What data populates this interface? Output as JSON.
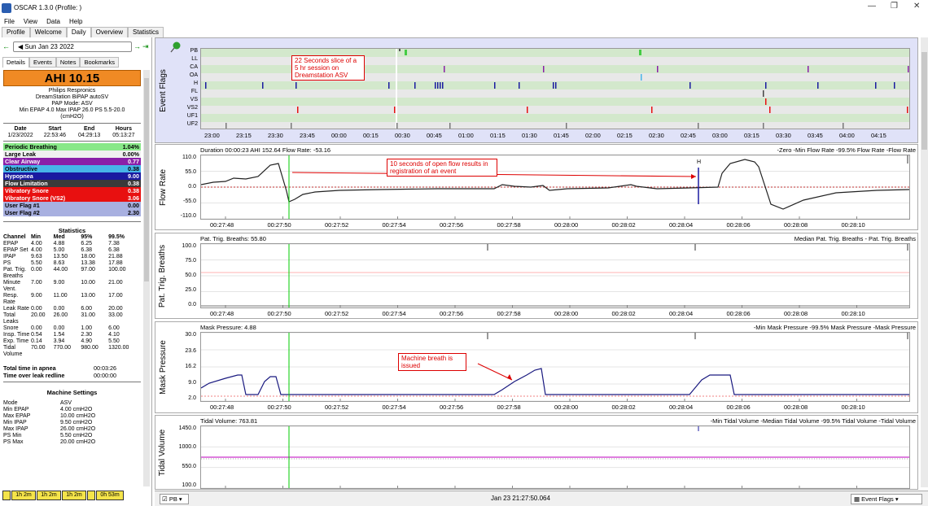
{
  "window": {
    "title": "OSCAR 1.3.0 (Profile: )"
  },
  "menu": [
    "File",
    "View",
    "Data",
    "Help"
  ],
  "tabs": [
    "Profile",
    "Welcome",
    "Daily",
    "Overview",
    "Statistics"
  ],
  "date": "Sun Jan 23 2022",
  "subtabs": [
    "Details",
    "Events",
    "Notes",
    "Bookmarks"
  ],
  "ahi": "AHI 10.15",
  "device": {
    "maker": "Philips Respronics",
    "model": "DreamStation BiPAP autoSV",
    "mode": "PAP Mode: ASV",
    "pressure": "Min EPAP 4.0 Max IPAP 26.0 PS 5.5-20.0",
    "unit": "(cmH2O)"
  },
  "session": {
    "headers": [
      "Date",
      "Start",
      "End",
      "Hours"
    ],
    "values": [
      "1/23/2022",
      "22:53:46",
      "04:29:13",
      "05:13:27"
    ]
  },
  "events": [
    {
      "label": "Periodic Breathing",
      "value": "1.04%",
      "color": "#88e888",
      "text": "#000"
    },
    {
      "label": "Large Leak",
      "value": "0.00%",
      "color": "#f0f0f0",
      "text": "#000"
    },
    {
      "label": "Clear Airway",
      "value": "0.77",
      "color": "#8a1fa8",
      "text": "#fff"
    },
    {
      "label": "Obstructive",
      "value": "0.38",
      "color": "#47b4e8",
      "text": "#000"
    },
    {
      "label": "Hypopnea",
      "value": "9.00",
      "color": "#1a1aa0",
      "text": "#fff"
    },
    {
      "label": "Flow Limitation",
      "value": "0.38",
      "color": "#3a3a3a",
      "text": "#fff"
    },
    {
      "label": "Vibratory Snore",
      "value": "0.38",
      "color": "#e81010",
      "text": "#fff"
    },
    {
      "label": "Vibratory Snore (VS2)",
      "value": "3.06",
      "color": "#e81010",
      "text": "#fff"
    },
    {
      "label": "User Flag #1",
      "value": "0.00",
      "color": "#a8b0e0",
      "text": "#000"
    },
    {
      "label": "User Flag #2",
      "value": "2.30",
      "color": "#a8b0e0",
      "text": "#000"
    }
  ],
  "stats_title": "Statistics",
  "stats_headers": [
    "Channel",
    "Min",
    "Med",
    "95%",
    "99.5%"
  ],
  "stats": [
    [
      "EPAP",
      "4.00",
      "4.88",
      "6.25",
      "7.38"
    ],
    [
      "EPAP Set",
      "4.00",
      "5.00",
      "6.38",
      "6.38"
    ],
    [
      "IPAP",
      "9.63",
      "13.50",
      "18.00",
      "21.88"
    ],
    [
      "PS",
      "5.50",
      "8.63",
      "13.38",
      "17.88"
    ],
    [
      "Pat. Trig. Breaths",
      "0.00",
      "44.00",
      "97.00",
      "100.00"
    ],
    [
      "Minute Vent.",
      "7.00",
      "9.00",
      "10.00",
      "21.00"
    ],
    [
      "Resp. Rate",
      "9.00",
      "11.00",
      "13.00",
      "17.00"
    ],
    [
      "Leak Rate",
      "0.00",
      "0.00",
      "6.00",
      "20.00"
    ],
    [
      "Total Leaks",
      "20.00",
      "26.00",
      "31.00",
      "33.00"
    ],
    [
      "Snore",
      "0.00",
      "0.00",
      "1.00",
      "6.00"
    ],
    [
      "Insp. Time",
      "0.54",
      "1.54",
      "2.30",
      "4.10"
    ],
    [
      "Exp. Time",
      "0.14",
      "3.94",
      "4.90",
      "5.50"
    ],
    [
      "Tidal Volume",
      "70.00",
      "770.00",
      "980.00",
      "1320.00"
    ]
  ],
  "totals": [
    {
      "label": "Total time in apnea",
      "value": "00:03:26"
    },
    {
      "label": "Time over leak redline",
      "value": "00:00:00"
    }
  ],
  "machine_title": "Machine Settings",
  "machine": [
    [
      "Mode",
      "ASV"
    ],
    [
      "Min EPAP",
      "4.00 cmH2O"
    ],
    [
      "Max EPAP",
      "10.00 cmH2O"
    ],
    [
      "Min IPAP",
      "9.50 cmH2O"
    ],
    [
      "Max IPAP",
      "26.00 cmH2O"
    ],
    [
      "PS Min",
      "5.50 cmH2O"
    ],
    [
      "PS Max",
      "20.00 cmH2O"
    ]
  ],
  "bottom_buttons": [
    "1h 2m",
    "1h 2m",
    "1h 2m",
    "0h 53m"
  ],
  "event_flags": {
    "ylabel": "Event Flags",
    "rows": [
      "PB",
      "LL",
      "CA",
      "OA",
      "H",
      "FL",
      "VS",
      "VS2",
      "UF1",
      "UF2"
    ],
    "times": [
      "23:00",
      "23:15",
      "23:30",
      "23:45",
      "00:00",
      "00:15",
      "00:30",
      "00:45",
      "01:00",
      "01:15",
      "01:30",
      "01:45",
      "02:00",
      "02:15",
      "02:30",
      "02:45",
      "03:00",
      "03:15",
      "03:30",
      "03:45",
      "04:00",
      "04:15"
    ],
    "annotation": "22 Seconds slice of a 5 hr session on Dreamstation ASV"
  },
  "flow": {
    "ylabel": "Flow Rate",
    "info": "Duration 00:00:23 AHI 152.64 Flow Rate: -53.16",
    "legend": "-Zero -Min Flow Rate -99.5% Flow Rate -Flow Rate",
    "yticks": [
      "110.0",
      "55.0",
      "0.0",
      "-55.0",
      "-110.0"
    ],
    "ylim": [
      -110,
      110
    ],
    "xticks": [
      "00:27:48",
      "00:27:50",
      "00:27:52",
      "00:27:54",
      "00:27:56",
      "00:27:58",
      "00:28:00",
      "00:28:02",
      "00:28:04",
      "00:28:06",
      "00:28:08",
      "00:28:10"
    ],
    "event_marker": "H",
    "annotation": "10 seconds of open flow results in registration of an event"
  },
  "ptb": {
    "ylabel": "Pat. Trig. Breaths",
    "info": "Pat. Trig. Breaths: 55.80",
    "legend": "Median Pat. Trig. Breaths - Pat. Trig. Breaths",
    "yticks": [
      "100.0",
      "75.0",
      "50.0",
      "25.0",
      "0.0"
    ],
    "xticks": [
      "00:27:48",
      "00:27:50",
      "00:27:52",
      "00:27:54",
      "00:27:56",
      "00:27:58",
      "00:28:00",
      "00:28:02",
      "00:28:04",
      "00:28:06",
      "00:28:08",
      "00:28:10"
    ]
  },
  "mask": {
    "ylabel": "Mask Pressure",
    "info": "Mask Pressure: 4.88",
    "legend": "-Min Mask Pressure -99.5% Mask Pressure -Mask Pressure",
    "yticks": [
      "30.0",
      "23.6",
      "16.2",
      "9.0",
      "2.0"
    ],
    "ylim": [
      2,
      30
    ],
    "xticks": [
      "00:27:48",
      "00:27:50",
      "00:27:52",
      "00:27:54",
      "00:27:56",
      "00:27:58",
      "00:28:00",
      "00:28:02",
      "00:28:04",
      "00:28:06",
      "00:28:08",
      "00:28:10"
    ],
    "annotation": "Machine breath is issued"
  },
  "tidal": {
    "ylabel": "Tidal Volume",
    "info": "Tidal Volume: 763.81",
    "legend": "-Min Tidal Volume -Median Tidal Volume -99.5% Tidal Volume -Tidal Volume",
    "yticks": [
      "1450.0",
      "1000.0",
      "550.0",
      "100.0"
    ]
  },
  "status": {
    "left": "PB",
    "center": "Jan 23 21:27:50.064",
    "right": "Event Flags"
  },
  "colors": {
    "accent": "#f08a24",
    "cursor": "#00cc00",
    "flagband": "#c8e6c0",
    "series_flow": "#222222"
  }
}
